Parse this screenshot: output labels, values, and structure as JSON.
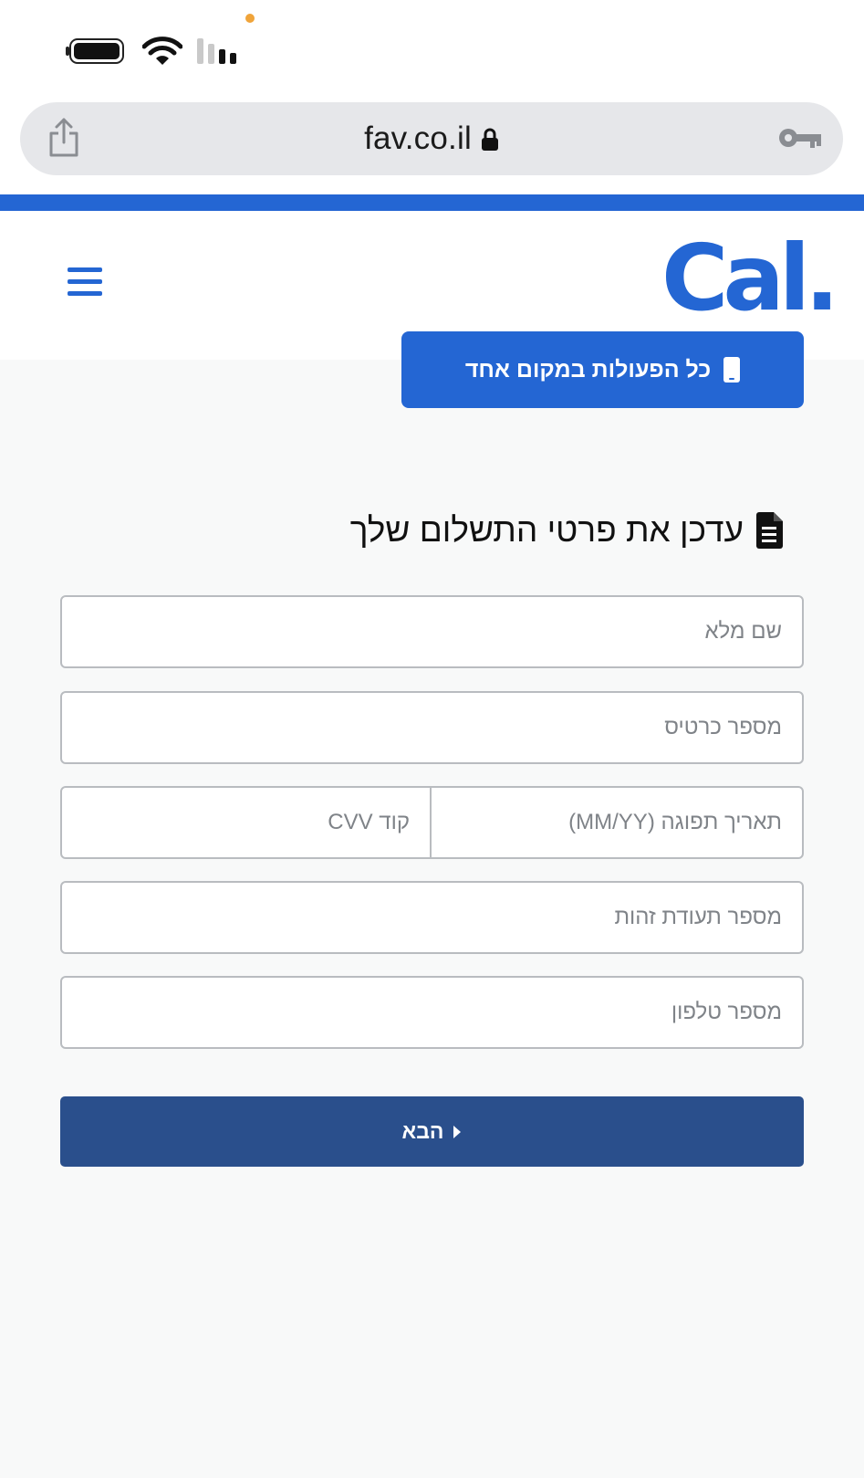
{
  "status_bar": {
    "battery_icon": "battery-full-icon",
    "wifi_icon": "wifi-icon",
    "signal_icon": "cellular-signal-icon",
    "privacy_indicator_color": "#f0a43a"
  },
  "browser": {
    "url": "fav.co.il",
    "share_icon": "share-icon",
    "lock_icon": "lock-icon",
    "password_icon": "key-icon"
  },
  "header": {
    "logo_text": "Cal.",
    "menu_icon": "hamburger-menu-icon",
    "all_actions_label": "כל הפעולות במקום אחד",
    "all_actions_icon": "phone-icon"
  },
  "form": {
    "title": "עדכן את פרטי התשלום שלך",
    "title_icon": "document-icon",
    "full_name_placeholder": "שם מלא",
    "card_number_placeholder": "מספר כרטיס",
    "expiry_placeholder": "תאריך תפוגה (MM/YY)",
    "cvv_placeholder": "קוד CVV",
    "id_number_placeholder": "מספר תעודת זהות",
    "phone_placeholder": "מספר טלפון",
    "next_label": "הבא",
    "next_icon": "caret-right-icon"
  },
  "colors": {
    "brand_blue": "#2466d3",
    "button_dark_blue": "#2a4f8c",
    "field_border": "#b9bcc0",
    "page_background": "#f8f9f9",
    "url_bar_background": "#e6e7ea"
  }
}
